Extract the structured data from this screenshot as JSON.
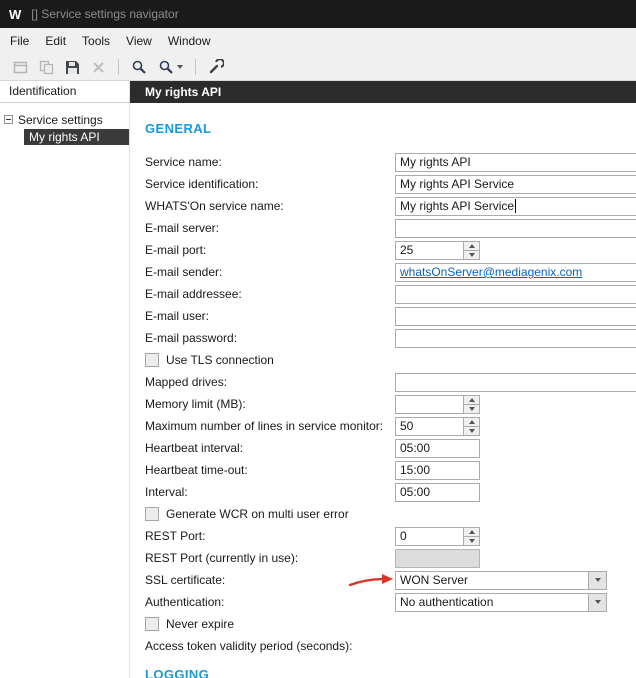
{
  "window": {
    "title": "[] Service settings navigator",
    "logo_letter": "W"
  },
  "menu_bar": {
    "items": [
      "File",
      "Edit",
      "Tools",
      "View",
      "Window"
    ]
  },
  "toolbar": {
    "icons": [
      {
        "name": "open-icon",
        "disabled": true
      },
      {
        "name": "copy-icon",
        "disabled": true
      },
      {
        "name": "save-icon",
        "disabled": false
      },
      {
        "name": "delete-icon",
        "disabled": true
      },
      {
        "name": "search-icon",
        "disabled": false
      },
      {
        "name": "search-options-icon",
        "disabled": false
      },
      {
        "name": "tools-icon",
        "disabled": false
      }
    ]
  },
  "sidebar": {
    "header": "Identification",
    "tree": [
      {
        "label": "Service settings",
        "level": 0,
        "expanded": true,
        "selected": false
      },
      {
        "label": "My rights API",
        "level": 1,
        "selected": true
      }
    ]
  },
  "main": {
    "header_title": "My rights API",
    "section_title": "GENERAL",
    "next_section_title": "LOGGING",
    "fields": [
      {
        "label": "Service name:",
        "type": "text",
        "size": "full",
        "value": "My rights API"
      },
      {
        "label": "Service identification:",
        "type": "text",
        "size": "full",
        "value": "My rights API Service"
      },
      {
        "label": "WHATS'On service name:",
        "type": "text",
        "size": "full",
        "value": "My rights API Service",
        "caret": true
      },
      {
        "label": "E-mail server:",
        "type": "text",
        "size": "full",
        "value": ""
      },
      {
        "label": "E-mail port:",
        "type": "spinner",
        "size": "small",
        "value": "25"
      },
      {
        "label": "E-mail sender:",
        "type": "link",
        "size": "full",
        "value": "whatsOnServer@mediagenix.com"
      },
      {
        "label": "E-mail addressee:",
        "type": "text",
        "size": "full",
        "value": ""
      },
      {
        "label": "E-mail user:",
        "type": "text",
        "size": "full",
        "value": ""
      },
      {
        "label": "E-mail password:",
        "type": "text",
        "size": "full",
        "value": ""
      },
      {
        "label": "Use TLS connection",
        "type": "checkbox",
        "checked": false
      },
      {
        "label": "Mapped drives:",
        "type": "text",
        "size": "full",
        "value": ""
      },
      {
        "label": "Memory limit (MB):",
        "type": "spinner",
        "size": "small",
        "value": ""
      },
      {
        "label": "Maximum number of lines in service monitor:",
        "type": "spinner",
        "size": "small",
        "value": "50"
      },
      {
        "label": "Heartbeat interval:",
        "type": "text",
        "size": "small",
        "value": "05:00"
      },
      {
        "label": "Heartbeat time-out:",
        "type": "text",
        "size": "small",
        "value": "15:00"
      },
      {
        "label": "Interval:",
        "type": "text",
        "size": "small",
        "value": "05:00"
      },
      {
        "label": "Generate WCR on multi user error",
        "type": "checkbox",
        "checked": false
      },
      {
        "label": "REST Port:",
        "type": "spinner",
        "size": "small",
        "value": "0"
      },
      {
        "label": "REST Port (currently in use):",
        "type": "disabled",
        "size": "small",
        "value": ""
      },
      {
        "label": "SSL certificate:",
        "type": "dropdown",
        "size": "combo",
        "value": "WON Server",
        "annotated": true
      },
      {
        "label": "Authentication:",
        "type": "dropdown",
        "size": "combo",
        "value": "No authentication"
      },
      {
        "label": "Never expire",
        "type": "checkbox",
        "checked": false
      },
      {
        "label": "Access token validity period (seconds):",
        "type": "none"
      }
    ]
  },
  "annotation": {
    "type": "arrow",
    "color": "#d6372b",
    "target_field": "SSL certificate:"
  },
  "colors": {
    "accent": "#189ad6",
    "link": "#0563c1",
    "selection": "#3a3a3a",
    "header_dark": "#2b2b2b",
    "annotation": "#d6372b"
  }
}
